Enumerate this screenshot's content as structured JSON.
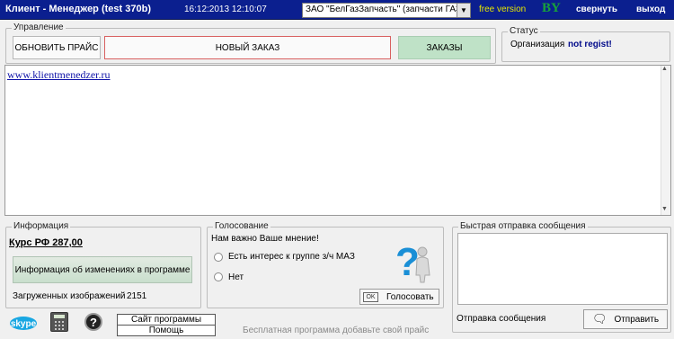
{
  "titlebar": {
    "app_title": "Клиент - Менеджер (test 370b)",
    "datetime": "16:12:2013  12:10:07",
    "company_selected": "ЗАО \"БелГазЗапчасть\" (запчасти ГАЗ)",
    "free_version": "free version",
    "by_logo": "BY",
    "minimize": "свернуть",
    "exit": "выход"
  },
  "control": {
    "legend": "Управление",
    "update_price": "ОБНОВИТЬ ПРАЙС",
    "new_order": "НОВЫЙ ЗАКАЗ",
    "orders": "ЗАКАЗЫ"
  },
  "status": {
    "legend": "Статус",
    "org_label": "Организация",
    "org_value": "not regist!"
  },
  "content": {
    "link": "www.klientmenedzer.ru"
  },
  "info": {
    "legend": "Информация",
    "rate": "Курс РФ  287,00",
    "changes_button": "Информация об изменениях в программе",
    "images_label": "Загруженных изображений",
    "images_count": "2151"
  },
  "poll": {
    "legend": "Голосование",
    "question": "Нам важно Ваше мнение!",
    "option1": "Есть интерес к группе з/ч МАЗ",
    "option2": "Нет",
    "vote_ok": "OK",
    "vote_button": "Голосовать"
  },
  "quick_message": {
    "legend": "Быстрая отправка сообщения",
    "send_label": "Отправка сообщения",
    "send_button": "Отправить"
  },
  "footer": {
    "skype": "skype",
    "site_button": "Сайт программы",
    "help_button": "Помощь",
    "note": "Бесплатная программа добавьте свой прайс"
  },
  "colors": {
    "titlebar": "#0b1f8f",
    "orders_button": "#bfe2c7",
    "new_order_border": "#d86060",
    "link": "#1014a8"
  }
}
